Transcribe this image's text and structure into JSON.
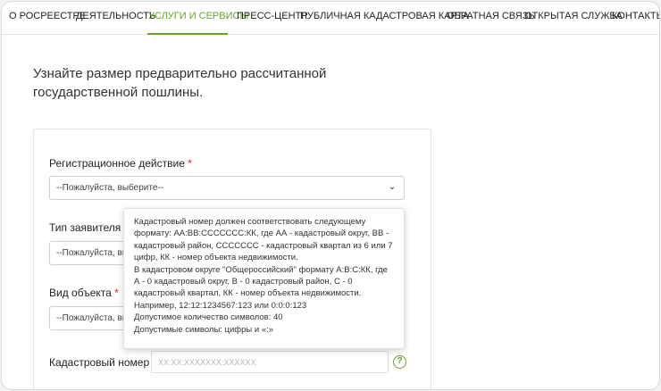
{
  "nav": {
    "items": [
      {
        "label": "О РОСРЕЕСТРЕ"
      },
      {
        "label": "ДЕЯТЕЛЬНОСТЬ"
      },
      {
        "label": "УСЛУГИ И СЕРВИСЫ",
        "active": true
      },
      {
        "label": "ПРЕСС-ЦЕНТР"
      },
      {
        "label": "ПУБЛИЧНАЯ КАДАСТРОВАЯ КАРТА"
      },
      {
        "label": "ОБРАТНАЯ СВЯЗЬ"
      },
      {
        "label": "ОТКРЫТАЯ СЛУЖБА"
      },
      {
        "label": "КОНТАКТЫ"
      }
    ]
  },
  "page": {
    "heading": "Узнайте размер предварительно рассчитанной государственной пошлины."
  },
  "form": {
    "registration_action": {
      "label": "Регистрационное действие",
      "required_mark": "*",
      "value": "--Пожалуйста, выберите--"
    },
    "applicant_type": {
      "label": "Тип заявителя",
      "required_mark": "*",
      "value": "--Пожалуйста, выберите--"
    },
    "object_type": {
      "label": "Вид объекта",
      "required_mark": "*",
      "value": "--Пожалуйста, выберите--"
    },
    "cadastral_number": {
      "label": "Кадастровый номер",
      "placeholder": "XX:XX:XXXXXXX:XXXXXX",
      "help_symbol": "?"
    }
  },
  "tooltip": {
    "lines": [
      "Кадастровый номер должен соответствовать следующему формату: АА:ВВ:CCCCCCC:КК, где АА - кадастровый округ, ВВ - кадастровый район, CCCCCCC - кадастровый квартал из 6 или 7 цифр, КК - номер объекта недвижимости.",
      "В кадастровом округе \"Общероссийский\" формату А:В:С:КК, где А - 0 кадастровый округ, В - 0 кадастровый район, С - 0 кадастровый квартал, КК - номер объекта недвижимости.",
      "Например, 12:12:1234567:123 или 0:0:0:123",
      "Допустимое количество символов: 40",
      "Допустимые символы: цифры и «:»"
    ]
  },
  "colors": {
    "accent": "#6aa32a",
    "required": "#d2232a"
  }
}
